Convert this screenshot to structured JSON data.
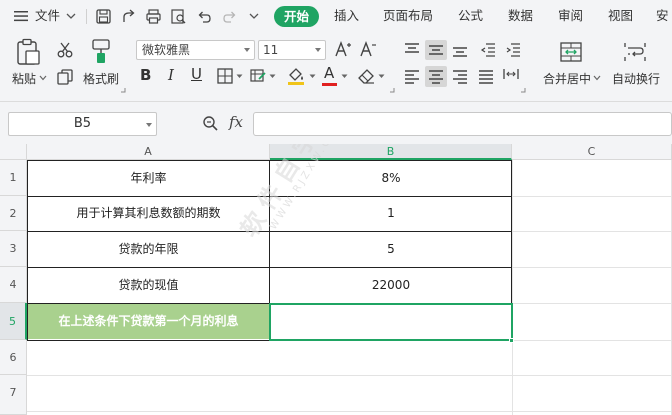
{
  "menu": {
    "file_label": "文件",
    "tabs": [
      "开始",
      "插入",
      "页面布局",
      "公式",
      "数据",
      "审阅",
      "视图",
      "安"
    ]
  },
  "ribbon": {
    "paste_label": "粘贴",
    "format_painter_label": "格式刷",
    "font_name": "微软雅黑",
    "font_size": "11",
    "font_grow": "A⁺",
    "font_shrink": "A⁻",
    "bold": "B",
    "italic": "I",
    "underline": "U",
    "font_color_glyph": "A",
    "merge_label": "合并居中",
    "wrap_label": "自动换行"
  },
  "formula_bar": {
    "cell_ref": "B5",
    "fx_label": "fx",
    "value": ""
  },
  "grid": {
    "columns": [
      "A",
      "B",
      "C"
    ],
    "rows": [
      "1",
      "2",
      "3",
      "4",
      "5",
      "6",
      "7"
    ],
    "cells": [
      {
        "label": "年利率",
        "value": "8%"
      },
      {
        "label": "用于计算其利息数额的期数",
        "value": "1"
      },
      {
        "label": "贷款的年限",
        "value": "5"
      },
      {
        "label": "贷款的现值",
        "value": "22000"
      },
      {
        "label": "在上述条件下贷款第一个月的利息",
        "value": ""
      }
    ],
    "selected_cell": "B5"
  },
  "watermark": {
    "text": "软件自学网",
    "sub": "WWW.RJZXW.COM"
  },
  "colors": {
    "accent": "#1fa463",
    "highlight_fill": "#a9d18e",
    "font_color_bar": "#e02020"
  }
}
